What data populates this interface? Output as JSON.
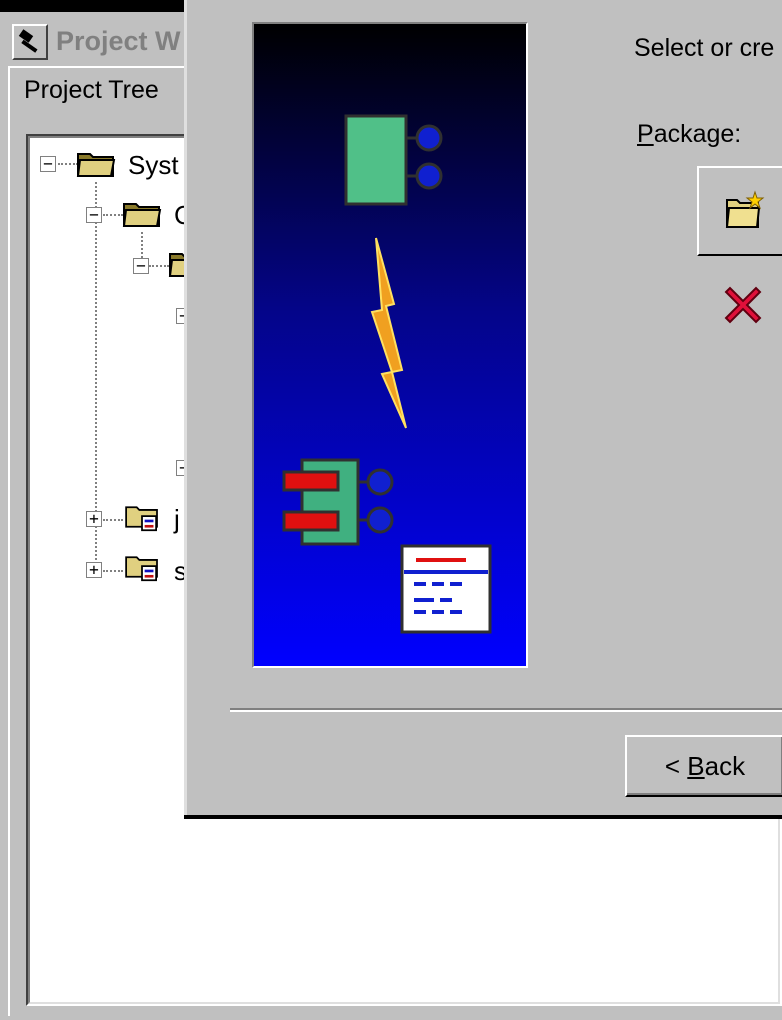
{
  "background_window": {
    "title": "Project W",
    "tree_label": "Project Tree",
    "tree_items": [
      {
        "label": "Syst",
        "expander": "−"
      },
      {
        "label": "C",
        "expander": "−"
      },
      {
        "label": "",
        "expander": "−"
      },
      {
        "label": "",
        "expander": "−"
      },
      {
        "label": "",
        "expander": "−"
      },
      {
        "label": "j",
        "expander": "+"
      },
      {
        "label": "s",
        "expander": "+"
      }
    ]
  },
  "dialog": {
    "prompt": "Select or cre",
    "package_label_mnemonic": "P",
    "package_label_rest": "ackage:",
    "back_button": {
      "prefix": "< ",
      "mnemonic": "B",
      "rest": "ack"
    }
  },
  "icons": {
    "title_icon": "hammer-icon",
    "new_package": "new-folder-icon",
    "delete": "delete-x-icon"
  },
  "colors": {
    "window_bg": "#c0c0c0",
    "graphic_top": "#000000",
    "graphic_bottom": "#0000ff",
    "delete": "#e0103a"
  }
}
